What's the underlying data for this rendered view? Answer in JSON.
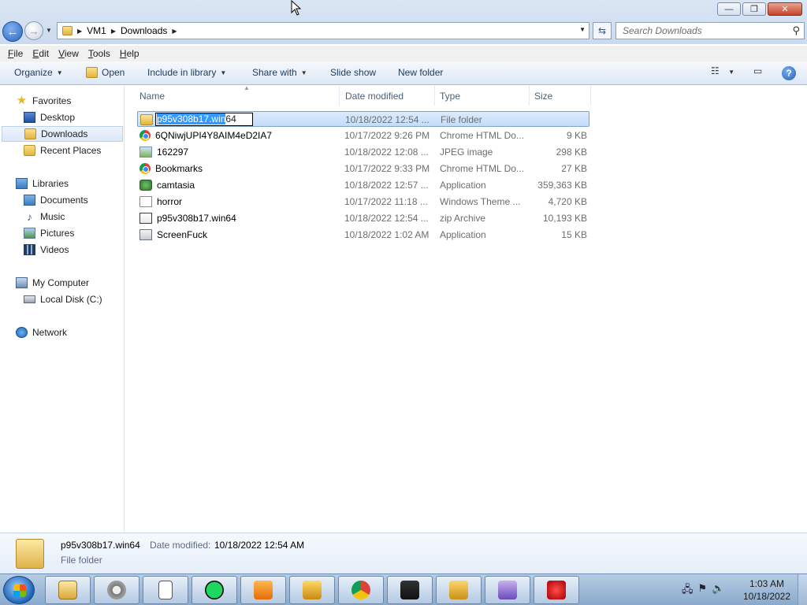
{
  "window": {
    "minimize_icon": "minimize-icon",
    "maximize_icon": "restore-icon",
    "close_icon": "close-icon"
  },
  "address": {
    "crumbs": [
      "VM1",
      "Downloads"
    ]
  },
  "search": {
    "placeholder": "Search Downloads"
  },
  "menu": {
    "items": [
      "File",
      "Edit",
      "View",
      "Tools",
      "Help"
    ]
  },
  "toolbar": {
    "organize": "Organize",
    "open": "Open",
    "include_in_library": "Include in library",
    "share_with": "Share with",
    "slide_show": "Slide show",
    "new_folder": "New folder"
  },
  "nav": {
    "favorites": "Favorites",
    "desktop": "Desktop",
    "downloads": "Downloads",
    "recent_places": "Recent Places",
    "libraries": "Libraries",
    "documents": "Documents",
    "music": "Music",
    "pictures": "Pictures",
    "videos": "Videos",
    "my_computer": "My Computer",
    "local_disk": "Local Disk (C:)",
    "network": "Network"
  },
  "columns": {
    "name": "Name",
    "date_modified": "Date modified",
    "type": "Type",
    "size": "Size"
  },
  "files": [
    {
      "name": "p95v308b17.win64",
      "date": "10/18/2022 12:54 ...",
      "type": "File folder",
      "size": "",
      "icon": "folder-icon"
    },
    {
      "name": "6QNiwjUPI4Y8AIM4eD2IA7",
      "date": "10/17/2022 9:26 PM",
      "type": "Chrome HTML Do...",
      "size": "9 KB",
      "icon": "chrome-icon"
    },
    {
      "name": "162297",
      "date": "10/18/2022 12:08 ...",
      "type": "JPEG image",
      "size": "298 KB",
      "icon": "image-icon"
    },
    {
      "name": "Bookmarks",
      "date": "10/17/2022 9:33 PM",
      "type": "Chrome HTML Do...",
      "size": "27 KB",
      "icon": "chrome-icon"
    },
    {
      "name": "camtasia",
      "date": "10/18/2022 12:57 ...",
      "type": "Application",
      "size": "359,363 KB",
      "icon": "camtasia-icon"
    },
    {
      "name": "horror",
      "date": "10/17/2022 11:18 ...",
      "type": "Windows Theme ...",
      "size": "4,720 KB",
      "icon": "theme-icon"
    },
    {
      "name": "p95v308b17.win64",
      "date": "10/18/2022 12:54 ...",
      "type": "zip Archive",
      "size": "10,193 KB",
      "icon": "zip-icon"
    },
    {
      "name": "ScreenFuck",
      "date": "10/18/2022 1:02 AM",
      "type": "Application",
      "size": "15 KB",
      "icon": "app-icon"
    }
  ],
  "rename": {
    "selected_part": "p95v308b17.win",
    "rest": "64"
  },
  "details": {
    "name": "p95v308b17.win64",
    "date_label": "Date modified:",
    "date_value": "10/18/2022 12:54 AM",
    "type": "File folder"
  },
  "taskbar": {
    "apps": [
      "explorer-icon",
      "settings-gear-icon",
      "solitaire-icon",
      "spotify-icon",
      "media-player-icon",
      "chess-king-icon",
      "chrome-icon",
      "dice-game-icon",
      "spades-icon",
      "spider-solitaire-icon",
      "hearts-icon"
    ],
    "clock_time": "1:03 AM",
    "clock_date": "10/18/2022"
  }
}
